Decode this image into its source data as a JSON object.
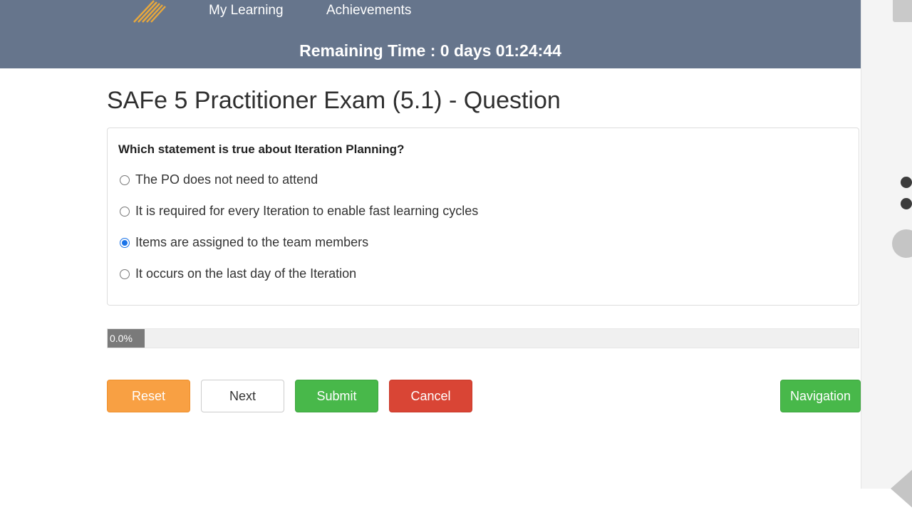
{
  "header": {
    "nav": {
      "my_learning": "My Learning",
      "achievements": "Achievements"
    },
    "remaining_time": "Remaining Time : 0 days 01:24:44"
  },
  "exam": {
    "title": "SAFe 5 Practitioner Exam (5.1) - Question",
    "question": "Which statement is true about Iteration Planning?",
    "options": [
      {
        "label": "The PO does not need to attend",
        "selected": false
      },
      {
        "label": "It is required for every Iteration to enable fast learning cycles",
        "selected": false
      },
      {
        "label": "Items are assigned to the team members",
        "selected": true
      },
      {
        "label": "It occurs on the last day of the Iteration",
        "selected": false
      }
    ]
  },
  "progress": {
    "value_percent": 0.0,
    "label": "0.0%"
  },
  "buttons": {
    "reset": "Reset",
    "next": "Next",
    "submit": "Submit",
    "cancel": "Cancel",
    "navigation": "Navigation"
  },
  "colors": {
    "header_bg": "#66758c",
    "reset": "#f8a043",
    "submit": "#48b84a",
    "cancel": "#d94535",
    "navigation": "#48b84a",
    "radio_selected": "#1a73e8"
  },
  "icons": {
    "logo": "striped-logo-icon",
    "side_top": "side-panel-tab-icon",
    "side_dots": "more-options-icon",
    "side_circle": "circle-button-icon",
    "side_back": "back-triangle-icon"
  }
}
